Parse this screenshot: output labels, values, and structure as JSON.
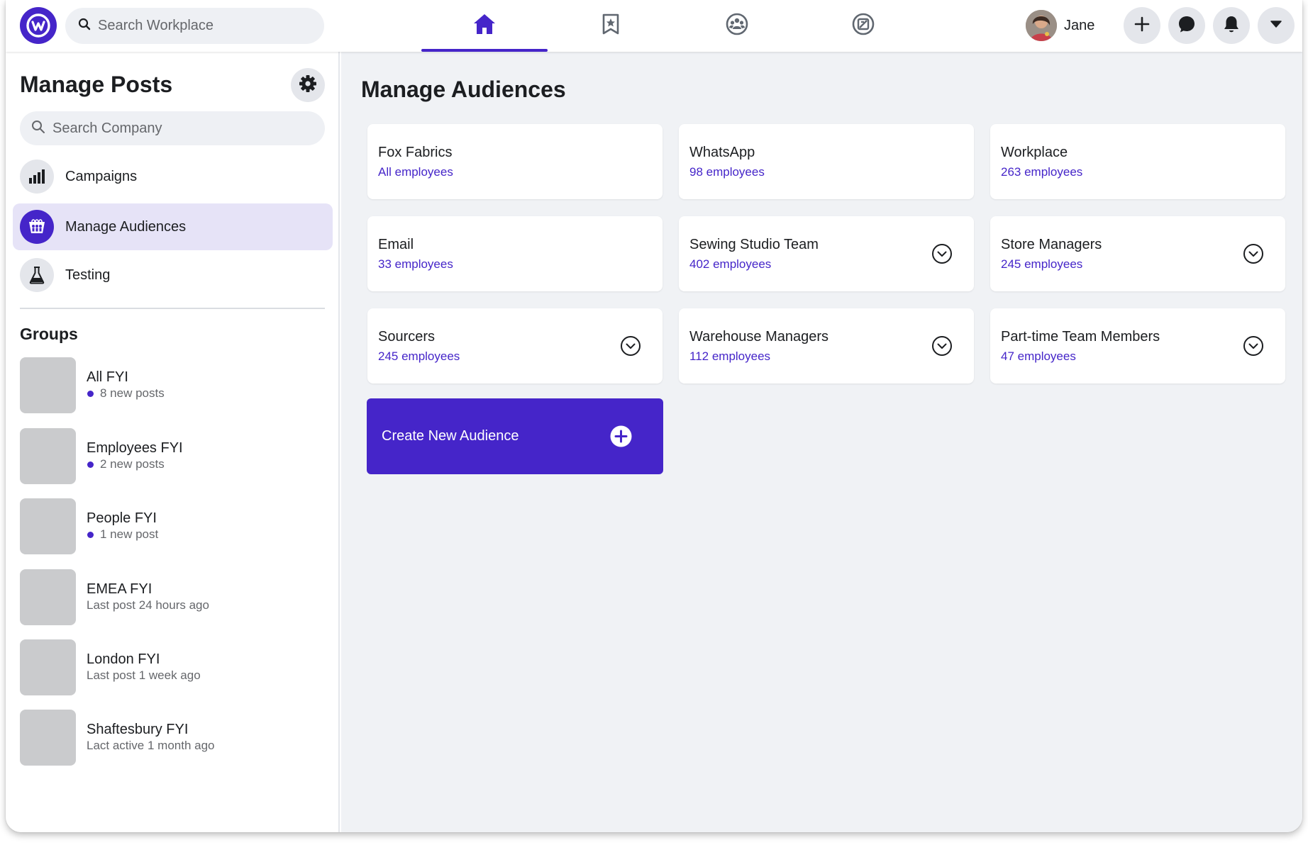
{
  "topbar": {
    "search_placeholder": "Search Workplace",
    "profile_name": "Jane",
    "nav_tabs": [
      {
        "name": "home",
        "icon": "home-icon",
        "active": true
      },
      {
        "name": "bookmark",
        "icon": "bookmark-star-icon",
        "active": false
      },
      {
        "name": "groups",
        "icon": "groups-icon",
        "active": false
      },
      {
        "name": "knowledge",
        "icon": "knowledge-icon",
        "active": false
      }
    ],
    "action_buttons": [
      "plus-icon",
      "chat-icon",
      "bell-icon",
      "caret-down-icon"
    ]
  },
  "sidebar": {
    "title": "Manage Posts",
    "search_placeholder": "Search Company",
    "menu": [
      {
        "label": "Campaigns",
        "icon": "bar-chart-icon",
        "active": false
      },
      {
        "label": "Manage Audiences",
        "icon": "audience-icon",
        "active": true
      },
      {
        "label": "Testing",
        "icon": "flask-icon",
        "active": false
      }
    ],
    "groups_title": "Groups",
    "groups": [
      {
        "name": "All FYI",
        "meta": "8 new posts",
        "unread": true
      },
      {
        "name": "Employees FYI",
        "meta": "2 new posts",
        "unread": true
      },
      {
        "name": "People FYI",
        "meta": "1 new post",
        "unread": true
      },
      {
        "name": "EMEA FYI",
        "meta": "Last post 24 hours ago",
        "unread": false
      },
      {
        "name": "London FYI",
        "meta": "Last post 1 week ago",
        "unread": false
      },
      {
        "name": "Shaftesbury FYI",
        "meta": "Lact active 1 month ago",
        "unread": false
      }
    ]
  },
  "main": {
    "title": "Manage Audiences",
    "audiences": [
      {
        "name": "Fox Fabrics",
        "count": "All employees",
        "expandable": false
      },
      {
        "name": "WhatsApp",
        "count": "98 employees",
        "expandable": false
      },
      {
        "name": "Workplace",
        "count": "263 employees",
        "expandable": false
      },
      {
        "name": "Email",
        "count": "33 employees",
        "expandable": false
      },
      {
        "name": "Sewing Studio Team",
        "count": "402 employees",
        "expandable": true
      },
      {
        "name": "Store Managers",
        "count": "245 employees",
        "expandable": true
      },
      {
        "name": "Sourcers",
        "count": "245 employees",
        "expandable": true
      },
      {
        "name": "Warehouse Managers",
        "count": "112 employees",
        "expandable": true
      },
      {
        "name": "Part-time Team Members",
        "count": "47 employees",
        "expandable": true
      }
    ],
    "create_label": "Create New Audience"
  },
  "colors": {
    "accent": "#4525c9",
    "accent_light": "#e6e3f7",
    "background": "#f0f2f5",
    "icon_bg": "#e4e6eb",
    "placeholder_thumb": "#cacbcd"
  }
}
